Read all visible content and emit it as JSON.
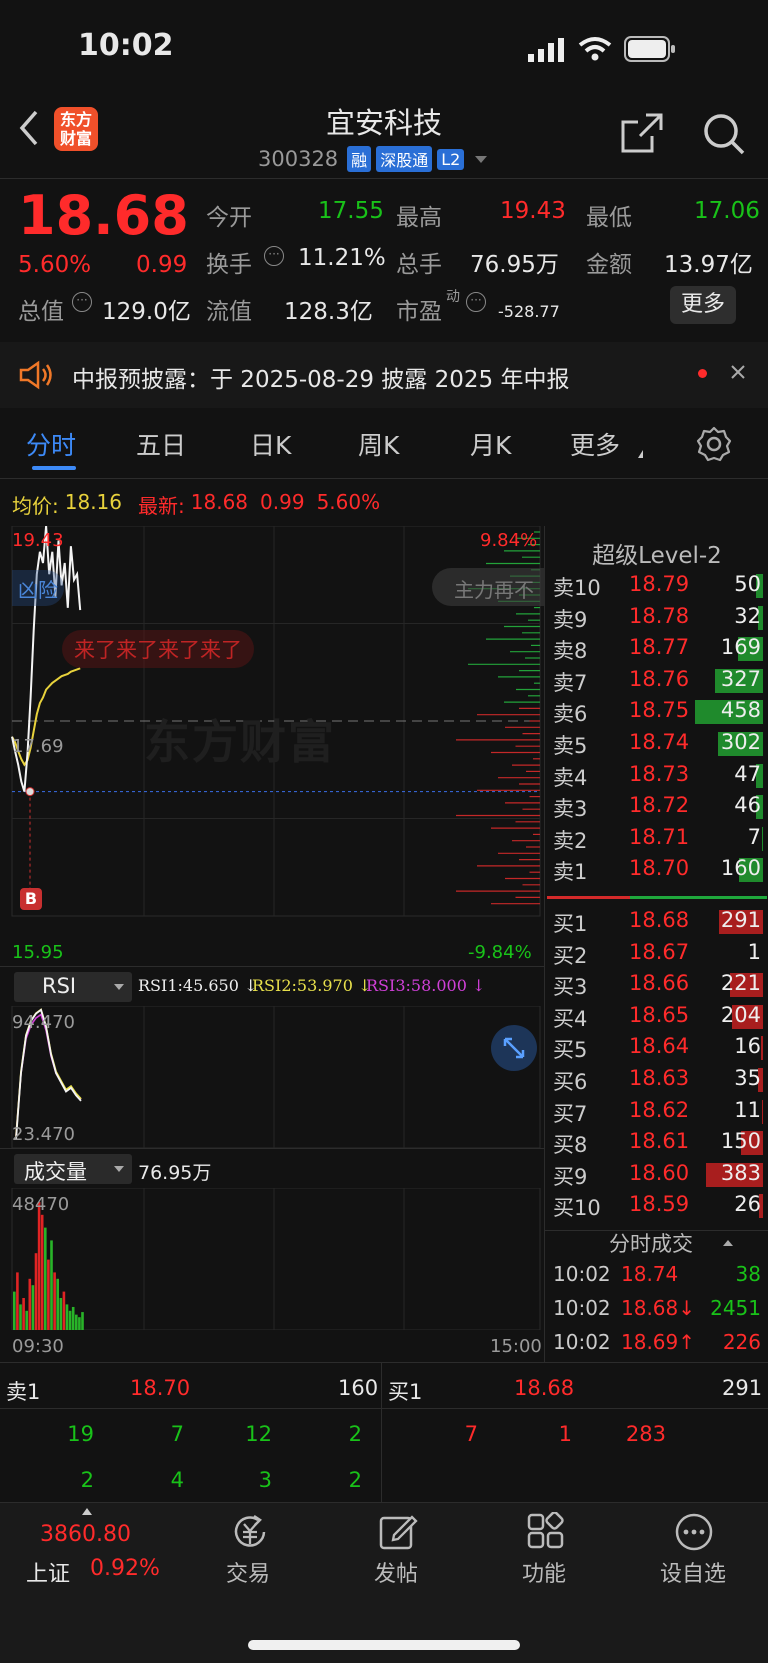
{
  "status": {
    "time": "10:02"
  },
  "header": {
    "logo_top": "东方",
    "logo_bottom": "财富",
    "stock_name": "宜安科技",
    "stock_code": "300328",
    "tags": [
      "融",
      "深股通",
      "L2"
    ]
  },
  "quote": {
    "price": "18.68",
    "pct": "5.60%",
    "change": "0.99",
    "open_label": "今开",
    "open": "17.55",
    "high_label": "最高",
    "high": "19.43",
    "low_label": "最低",
    "low": "17.06",
    "turnover_label": "换手",
    "turnover": "11.21%",
    "volume_label": "总手",
    "volume": "76.95万",
    "amount_label": "金额",
    "amount": "13.97亿",
    "mktcap_label": "总值",
    "mktcap": "129.0亿",
    "float_label": "流值",
    "float": "128.3亿",
    "pe_label": "市盈",
    "pe_sup": "动",
    "pe": "-528.77",
    "more": "更多"
  },
  "notice": {
    "text": "中报预披露：于 2025-08-29 披露 2025 年中报"
  },
  "tabs": [
    "分时",
    "五日",
    "日K",
    "周K",
    "月K",
    "更多"
  ],
  "chart_info": {
    "avg_label": "均价:",
    "avg": "18.16",
    "last_label": "最新:",
    "last": "18.68",
    "chg": "0.99",
    "pct": "5.60%"
  },
  "chart_data": {
    "type": "line",
    "title": "",
    "y_range": [
      15.95,
      19.43
    ],
    "y_labels": {
      "top": "19.43",
      "mid": "17.69",
      "bottom": "15.95",
      "top_pct": "9.84%",
      "bottom_pct": "-9.84%"
    },
    "x_labels": {
      "start": "09:30",
      "end": "15:00"
    },
    "series": [
      {
        "name": "价格",
        "values": [
          17.55,
          17.42,
          17.3,
          17.15,
          17.06,
          17.4,
          17.9,
          18.5,
          19.0,
          19.2,
          19.1,
          19.43,
          19.0,
          19.2,
          18.8,
          19.3,
          18.9,
          19.1,
          18.7,
          19.25,
          18.95,
          19.0,
          18.68
        ]
      },
      {
        "name": "均价",
        "values": [
          17.55,
          17.5,
          17.42,
          17.35,
          17.3,
          17.34,
          17.45,
          17.6,
          17.75,
          17.85,
          17.9,
          17.97,
          18.0,
          18.03,
          18.05,
          18.07,
          18.09,
          18.1,
          18.11,
          18.13,
          18.14,
          18.15,
          18.16
        ]
      }
    ],
    "tags": {
      "left": "凶险",
      "right": "主力再不",
      "note": "来了来了来了来了",
      "b_marker": "B"
    },
    "watermark": "东方财富"
  },
  "rsi": {
    "label": "RSI",
    "r1": "RSI1:45.650 ↓",
    "r2": "RSI2:53.970 ↓",
    "r3": "RSI3:58.000 ↓",
    "top": "94.470",
    "bottom": "23.470",
    "values": [
      24,
      60,
      80,
      88,
      92,
      94,
      85,
      70,
      60,
      55,
      50,
      52,
      48,
      45
    ]
  },
  "vol": {
    "label": "成交量",
    "total": "76.95万",
    "max": "48470",
    "bars": [
      30,
      45,
      20,
      25,
      15,
      40,
      35,
      60,
      100,
      90,
      80,
      55,
      70,
      45,
      40,
      25,
      30,
      20,
      15,
      18,
      12,
      10,
      14
    ]
  },
  "orderbook": {
    "title": "超级Level-2",
    "asks": [
      {
        "label": "卖10",
        "price": "18.79",
        "qty": "50",
        "fill": 0.11
      },
      {
        "label": "卖9",
        "price": "18.78",
        "qty": "32",
        "fill": 0.07
      },
      {
        "label": "卖8",
        "price": "18.77",
        "qty": "169",
        "fill": 0.37
      },
      {
        "label": "卖7",
        "price": "18.76",
        "qty": "327",
        "fill": 0.71
      },
      {
        "label": "卖6",
        "price": "18.75",
        "qty": "458",
        "fill": 1.0
      },
      {
        "label": "卖5",
        "price": "18.74",
        "qty": "302",
        "fill": 0.66
      },
      {
        "label": "卖4",
        "price": "18.73",
        "qty": "47",
        "fill": 0.1
      },
      {
        "label": "卖3",
        "price": "18.72",
        "qty": "46",
        "fill": 0.1
      },
      {
        "label": "卖2",
        "price": "18.71",
        "qty": "7",
        "fill": 0.02
      },
      {
        "label": "卖1",
        "price": "18.70",
        "qty": "160",
        "fill": 0.35
      }
    ],
    "bids": [
      {
        "label": "买1",
        "price": "18.68",
        "qty": "291",
        "fill": 0.64
      },
      {
        "label": "买2",
        "price": "18.67",
        "qty": "1",
        "fill": 0.0
      },
      {
        "label": "买3",
        "price": "18.66",
        "qty": "221",
        "fill": 0.48
      },
      {
        "label": "买4",
        "price": "18.65",
        "qty": "204",
        "fill": 0.45
      },
      {
        "label": "买5",
        "price": "18.64",
        "qty": "16",
        "fill": 0.03
      },
      {
        "label": "买6",
        "price": "18.63",
        "qty": "35",
        "fill": 0.08
      },
      {
        "label": "买7",
        "price": "18.62",
        "qty": "11",
        "fill": 0.02
      },
      {
        "label": "买8",
        "price": "18.61",
        "qty": "150",
        "fill": 0.33
      },
      {
        "label": "买9",
        "price": "18.60",
        "qty": "383",
        "fill": 0.84
      },
      {
        "label": "买10",
        "price": "18.59",
        "qty": "26",
        "fill": 0.06
      }
    ],
    "trades_title": "分时成交",
    "trades": [
      {
        "time": "10:02",
        "price": "18.74",
        "qty": "38",
        "dir": ""
      },
      {
        "time": "10:02",
        "price": "18.68↓",
        "qty": "2451",
        "dir": "down"
      },
      {
        "time": "10:02",
        "price": "18.69↑",
        "qty": "226",
        "dir": "up"
      }
    ]
  },
  "queue": {
    "ask_label": "卖1",
    "ask_price": "18.70",
    "ask_qty": "160",
    "bid_label": "买1",
    "bid_price": "18.68",
    "bid_qty": "291",
    "ask_orders": [
      [
        "19",
        "7",
        "12",
        "2"
      ],
      [
        "2",
        "4",
        "3",
        "2"
      ]
    ],
    "bid_orders": [
      "7",
      "1",
      "283"
    ]
  },
  "bottom_nav": {
    "index_value": "3860.80",
    "index_name": "上证",
    "index_pct": "0.92%",
    "items": [
      "交易",
      "发帖",
      "功能",
      "设自选"
    ]
  }
}
